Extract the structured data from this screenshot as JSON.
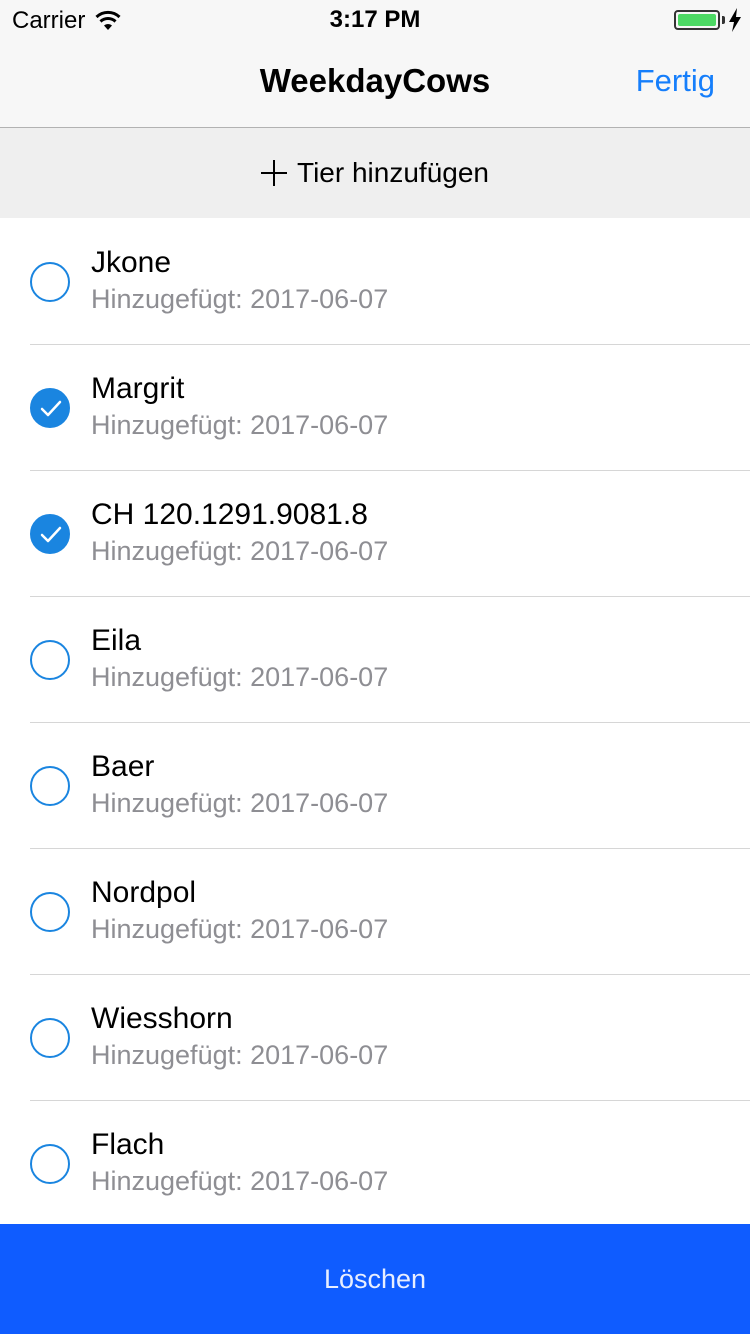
{
  "status_bar": {
    "carrier": "Carrier",
    "time": "3:17 PM",
    "battery_level": 1.0
  },
  "nav": {
    "title": "WeekdayCows",
    "done_label": "Fertig"
  },
  "add_animal": {
    "label": "Tier hinzufügen",
    "icon": "plus-icon"
  },
  "animals": [
    {
      "name": "Jkone",
      "added": "Hinzugefügt: 2017-06-07",
      "selected": false
    },
    {
      "name": "Margrit",
      "added": "Hinzugefügt: 2017-06-07",
      "selected": true
    },
    {
      "name": "CH 120.1291.9081.8",
      "added": "Hinzugefügt: 2017-06-07",
      "selected": true
    },
    {
      "name": "Eila",
      "added": "Hinzugefügt: 2017-06-07",
      "selected": false
    },
    {
      "name": "Baer",
      "added": "Hinzugefügt: 2017-06-07",
      "selected": false
    },
    {
      "name": "Nordpol",
      "added": "Hinzugefügt: 2017-06-07",
      "selected": false
    },
    {
      "name": "Wiesshorn",
      "added": "Hinzugefügt: 2017-06-07",
      "selected": false
    },
    {
      "name": "Flach",
      "added": "Hinzugefügt: 2017-06-07",
      "selected": false
    }
  ],
  "delete_button": {
    "label": "Löschen"
  },
  "colors": {
    "accent": "#157efb",
    "checkbox": "#1a85e0",
    "delete_bar": "#0f5cff",
    "battery": "#4cd964"
  }
}
